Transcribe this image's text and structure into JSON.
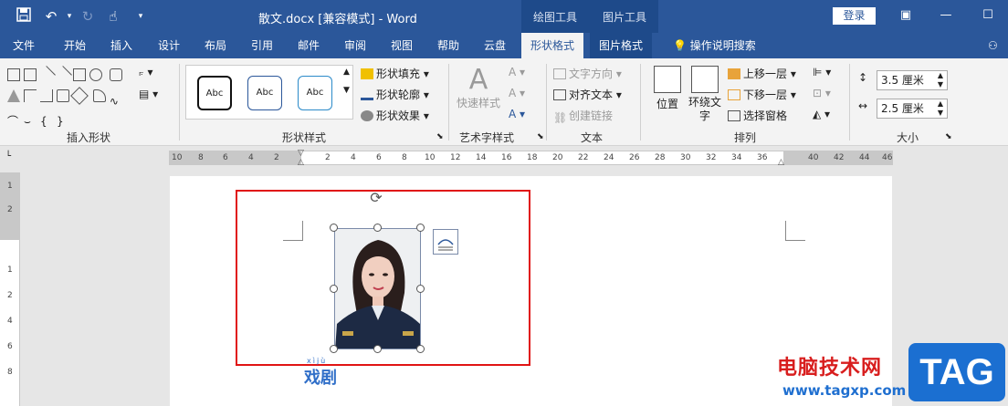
{
  "titlebar": {
    "title": "散文.docx [兼容模式]  -  Word",
    "context_tabs": [
      "绘图工具",
      "图片工具"
    ],
    "login": "登录",
    "icons": [
      "save-icon",
      "undo-icon",
      "redo-icon",
      "touch-mode-icon",
      "customize-icon",
      "ribbon-display-icon",
      "minimize-icon",
      "maximize-icon"
    ]
  },
  "tabs": [
    "文件",
    "开始",
    "插入",
    "设计",
    "布局",
    "引用",
    "邮件",
    "审阅",
    "视图",
    "帮助",
    "云盘",
    "形状格式",
    "图片格式",
    "操作说明搜索"
  ],
  "ribbon": {
    "groups": [
      "插入形状",
      "形状样式",
      "艺术字样式",
      "文本",
      "排列",
      "大小"
    ],
    "style_samples": [
      "Abc",
      "Abc",
      "Abc"
    ],
    "shape_style_items": [
      "形状填充",
      "形状轮廓",
      "形状效果"
    ],
    "wordart_items": [
      "快速样式"
    ],
    "text_items": [
      "文字方向",
      "对齐文本",
      "创建链接"
    ],
    "arrange_big": [
      "位置",
      "环绕文字"
    ],
    "arrange_items": [
      "上移一层",
      "下移一层",
      "选择窗格"
    ],
    "size": {
      "height": "3.5 厘米",
      "width": "2.5 厘米"
    }
  },
  "ruler": {
    "h_labels": [
      "10",
      "8",
      "6",
      "4",
      "2",
      "2",
      "4",
      "6",
      "8",
      "10",
      "12",
      "14",
      "16",
      "18",
      "20",
      "22",
      "24",
      "26",
      "28",
      "30",
      "32",
      "34",
      "36",
      "40",
      "42",
      "44",
      "46"
    ],
    "v_labels": [
      "1",
      "2",
      "1",
      "2",
      "4",
      "6",
      "8"
    ]
  },
  "document": {
    "ruby": "xìjù",
    "text": "戏剧"
  },
  "watermark": {
    "site": "电脑技术网",
    "url": "www.tagxp.com",
    "tag": "TAG"
  }
}
